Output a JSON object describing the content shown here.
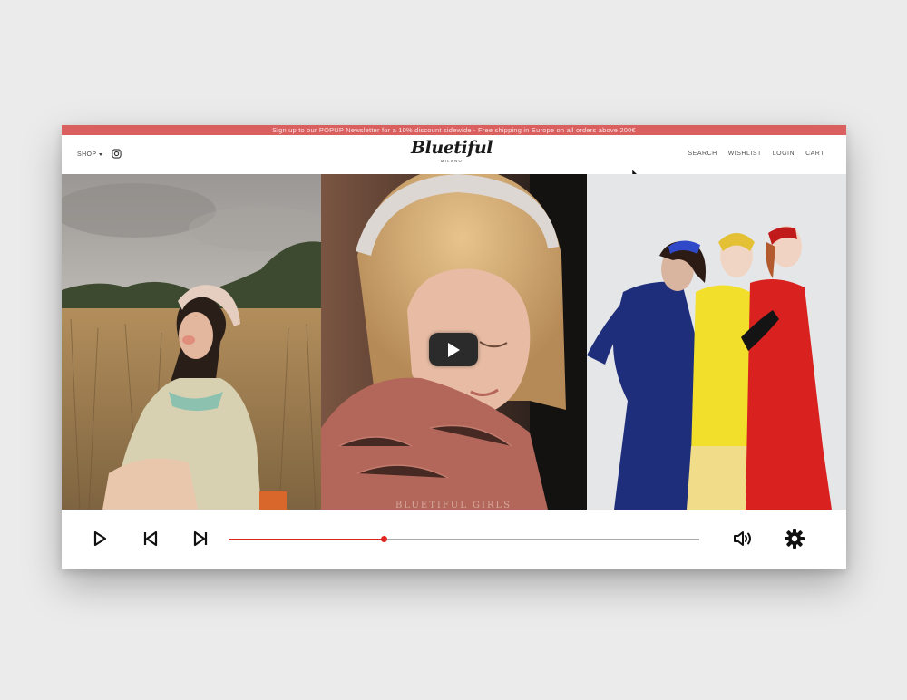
{
  "promo": {
    "text": "Sign up to our POPUP Newsletter for a 10% discount sidewide - Free shipping in Europe on all orders above 200€",
    "color": "#d9605f"
  },
  "header": {
    "shop_label": "SHOP",
    "logo": "Bluetiful",
    "logo_sub": "MILANO",
    "nav": [
      "SEARCH",
      "WISHLIST",
      "LOGIN",
      "CART"
    ]
  },
  "hero": {
    "video_watermark": "BLUETIFUL GIRLS"
  },
  "player": {
    "progress": 0.33,
    "accent": "#e0241f",
    "icons": [
      "play-icon",
      "previous-icon",
      "next-icon",
      "volume-icon",
      "settings-gear-icon"
    ]
  }
}
